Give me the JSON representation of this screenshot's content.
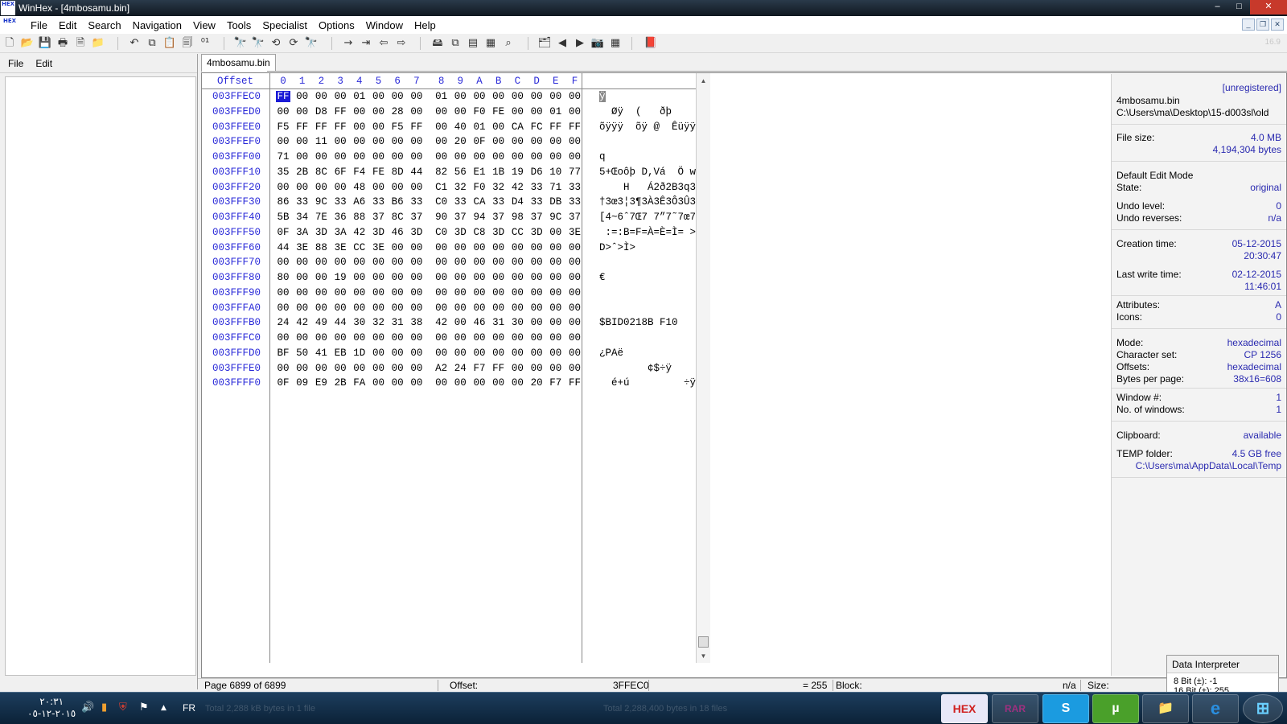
{
  "window": {
    "title": "WinHex - [4mbosamu.bin]",
    "app_icon_text": "HEX",
    "minimize": "–",
    "maximize": "□",
    "close": "✕"
  },
  "menu": [
    "File",
    "Edit",
    "Search",
    "Navigation",
    "View",
    "Tools",
    "Specialist",
    "Options",
    "Window",
    "Help"
  ],
  "mdi_controls": {
    "minimize": "_",
    "restore": "❐",
    "close": "✕"
  },
  "toolbar": {
    "version": "16.9",
    "icons": [
      "new-file-icon",
      "open-folder-icon",
      "save-icon",
      "print-icon",
      "properties-icon",
      "open-disk-icon",
      "undo-icon",
      "copy-icon",
      "paste-icon",
      "clipboard-data-icon",
      "convert-binary-icon",
      "find-text-icon",
      "find-hex-icon",
      "replace-text-icon",
      "replace-hex-icon",
      "find-again-icon",
      "goto-offset-icon",
      "goto-page-icon",
      "back-icon",
      "forward-icon",
      "open-disk-edit-icon",
      "clone-icon",
      "ram-icon",
      "calculator-icon",
      "magnifier-icon",
      "case-icon",
      "prev-page-icon",
      "next-page-icon",
      "camera-icon",
      "table-icon",
      "help-book-icon"
    ],
    "glyphs": [
      "🗋",
      "📂",
      "💾",
      "🖶",
      "🗎",
      "📁",
      "↶",
      "⧉",
      "📋",
      "🗐",
      "⁰¹",
      "🔭",
      "🔭",
      "⟲",
      "⟳",
      "🔭",
      "→",
      "⇥",
      "⇦",
      "⇨",
      "🖴",
      "⧉",
      "▤",
      "▦",
      "⌕",
      "🗂",
      "◀",
      "▶",
      "📷",
      "▦",
      "📕"
    ]
  },
  "left_panel": {
    "menu": [
      "File",
      "Edit"
    ]
  },
  "tab": {
    "label": "4mbosamu.bin"
  },
  "hex": {
    "header_offset": "Offset",
    "header_cols": [
      "0",
      "1",
      "2",
      "3",
      "4",
      "5",
      "6",
      "7",
      "8",
      "9",
      "A",
      "B",
      "C",
      "D",
      "E",
      "F"
    ],
    "rows": [
      {
        "offset": "003FFEC0",
        "bytes": [
          "FF",
          "00",
          "00",
          "00",
          "01",
          "00",
          "00",
          "00",
          "01",
          "00",
          "00",
          "00",
          "00",
          "00",
          "00",
          "00"
        ],
        "ascii": "ÿ"
      },
      {
        "offset": "003FFED0",
        "bytes": [
          "00",
          "00",
          "D8",
          "FF",
          "00",
          "00",
          "28",
          "00",
          "00",
          "00",
          "F0",
          "FE",
          "00",
          "00",
          "01",
          "00"
        ],
        "ascii": "  Øÿ  (   ðþ"
      },
      {
        "offset": "003FFEE0",
        "bytes": [
          "F5",
          "FF",
          "FF",
          "FF",
          "00",
          "00",
          "F5",
          "FF",
          "00",
          "40",
          "01",
          "00",
          "CA",
          "FC",
          "FF",
          "FF"
        ],
        "ascii": "õÿÿÿ  õÿ @  Êüÿÿ"
      },
      {
        "offset": "003FFEF0",
        "bytes": [
          "00",
          "00",
          "11",
          "00",
          "00",
          "00",
          "00",
          "00",
          "00",
          "20",
          "0F",
          "00",
          "00",
          "00",
          "00",
          "00"
        ],
        "ascii": ""
      },
      {
        "offset": "003FFF00",
        "bytes": [
          "71",
          "00",
          "00",
          "00",
          "00",
          "00",
          "00",
          "00",
          "00",
          "00",
          "00",
          "00",
          "00",
          "00",
          "00",
          "00"
        ],
        "ascii": "q"
      },
      {
        "offset": "003FFF10",
        "bytes": [
          "35",
          "2B",
          "8C",
          "6F",
          "F4",
          "FE",
          "8D",
          "44",
          "82",
          "56",
          "E1",
          "1B",
          "19",
          "D6",
          "10",
          "77"
        ],
        "ascii": "5+Œoôþ D,Vá  Ö w"
      },
      {
        "offset": "003FFF20",
        "bytes": [
          "00",
          "00",
          "00",
          "00",
          "48",
          "00",
          "00",
          "00",
          "C1",
          "32",
          "F0",
          "32",
          "42",
          "33",
          "71",
          "33"
        ],
        "ascii": "    H   Á2ð2B3q3"
      },
      {
        "offset": "003FFF30",
        "bytes": [
          "86",
          "33",
          "9C",
          "33",
          "A6",
          "33",
          "B6",
          "33",
          "C0",
          "33",
          "CA",
          "33",
          "D4",
          "33",
          "DB",
          "33"
        ],
        "ascii": "†3œ3¦3¶3À3Ê3Ô3Û3"
      },
      {
        "offset": "003FFF40",
        "bytes": [
          "5B",
          "34",
          "7E",
          "36",
          "88",
          "37",
          "8C",
          "37",
          "90",
          "37",
          "94",
          "37",
          "98",
          "37",
          "9C",
          "37"
        ],
        "ascii": "[4~6ˆ7Œ7 7”7˜7œ7"
      },
      {
        "offset": "003FFF50",
        "bytes": [
          "0F",
          "3A",
          "3D",
          "3A",
          "42",
          "3D",
          "46",
          "3D",
          "C0",
          "3D",
          "C8",
          "3D",
          "CC",
          "3D",
          "00",
          "3E"
        ],
        "ascii": " :=:B=F=À=È=Ì= >"
      },
      {
        "offset": "003FFF60",
        "bytes": [
          "44",
          "3E",
          "88",
          "3E",
          "CC",
          "3E",
          "00",
          "00",
          "00",
          "00",
          "00",
          "00",
          "00",
          "00",
          "00",
          "00"
        ],
        "ascii": "D>ˆ>Ì>"
      },
      {
        "offset": "003FFF70",
        "bytes": [
          "00",
          "00",
          "00",
          "00",
          "00",
          "00",
          "00",
          "00",
          "00",
          "00",
          "00",
          "00",
          "00",
          "00",
          "00",
          "00"
        ],
        "ascii": ""
      },
      {
        "offset": "003FFF80",
        "bytes": [
          "80",
          "00",
          "00",
          "19",
          "00",
          "00",
          "00",
          "00",
          "00",
          "00",
          "00",
          "00",
          "00",
          "00",
          "00",
          "00"
        ],
        "ascii": "€"
      },
      {
        "offset": "003FFF90",
        "bytes": [
          "00",
          "00",
          "00",
          "00",
          "00",
          "00",
          "00",
          "00",
          "00",
          "00",
          "00",
          "00",
          "00",
          "00",
          "00",
          "00"
        ],
        "ascii": ""
      },
      {
        "offset": "003FFFA0",
        "bytes": [
          "00",
          "00",
          "00",
          "00",
          "00",
          "00",
          "00",
          "00",
          "00",
          "00",
          "00",
          "00",
          "00",
          "00",
          "00",
          "00"
        ],
        "ascii": ""
      },
      {
        "offset": "003FFFB0",
        "bytes": [
          "24",
          "42",
          "49",
          "44",
          "30",
          "32",
          "31",
          "38",
          "42",
          "00",
          "46",
          "31",
          "30",
          "00",
          "00",
          "00"
        ],
        "ascii": "$BID0218B F10"
      },
      {
        "offset": "003FFFC0",
        "bytes": [
          "00",
          "00",
          "00",
          "00",
          "00",
          "00",
          "00",
          "00",
          "00",
          "00",
          "00",
          "00",
          "00",
          "00",
          "00",
          "00"
        ],
        "ascii": ""
      },
      {
        "offset": "003FFFD0",
        "bytes": [
          "BF",
          "50",
          "41",
          "EB",
          "1D",
          "00",
          "00",
          "00",
          "00",
          "00",
          "00",
          "00",
          "00",
          "00",
          "00",
          "00"
        ],
        "ascii": "¿PAë"
      },
      {
        "offset": "003FFFE0",
        "bytes": [
          "00",
          "00",
          "00",
          "00",
          "00",
          "00",
          "00",
          "00",
          "A2",
          "24",
          "F7",
          "FF",
          "00",
          "00",
          "00",
          "00"
        ],
        "ascii": "        ¢$÷ÿ"
      },
      {
        "offset": "003FFFF0",
        "bytes": [
          "0F",
          "09",
          "E9",
          "2B",
          "FA",
          "00",
          "00",
          "00",
          "00",
          "00",
          "00",
          "00",
          "00",
          "20",
          "F7",
          "FF"
        ],
        "ascii": "  é+ú         ÷ÿ"
      }
    ]
  },
  "info": {
    "registration": "[unregistered]",
    "filename": "4mbosamu.bin",
    "path": "C:\\Users\\ma\\Desktop\\15-d003sl\\old",
    "file_size_label": "File size:",
    "file_size": "4.0 MB",
    "file_size_bytes": "4,194,304 bytes",
    "edit_mode": "Default Edit Mode",
    "state_label": "State:",
    "state": "original",
    "undo_level_label": "Undo level:",
    "undo_level": "0",
    "undo_reverses_label": "Undo reverses:",
    "undo_reverses": "n/a",
    "creation_label": "Creation time:",
    "creation_date": "05-12-2015",
    "creation_time": "20:30:47",
    "write_label": "Last write time:",
    "write_date": "02-12-2015",
    "write_time": "11:46:01",
    "attributes_label": "Attributes:",
    "attributes": "A",
    "icons_label": "Icons:",
    "icons": "0",
    "mode_label": "Mode:",
    "mode": "hexadecimal",
    "charset_label": "Character set:",
    "charset": "CP 1256",
    "offsets_label": "Offsets:",
    "offsets": "hexadecimal",
    "bpp_label": "Bytes per page:",
    "bpp": "38x16=608",
    "window_label": "Window #:",
    "window_no": "1",
    "nwindows_label": "No. of windows:",
    "nwindows": "1",
    "clipboard_label": "Clipboard:",
    "clipboard": "available",
    "temp_label": "TEMP folder:",
    "temp_free": "4.5 GB free",
    "temp_path": "C:\\Users\\ma\\AppData\\Local\\Temp"
  },
  "status": {
    "page": "Page 6899 of 6899",
    "offset_label": "Offset:",
    "offset": "3FFEC0",
    "value": "= 255",
    "block_label": "Block:",
    "block": "n/a",
    "size_label": "Size:"
  },
  "data_interpreter": {
    "title": "Data Interpreter",
    "line1": "8 Bit (±): -1",
    "line2": "16 Bit (±): 255"
  },
  "taskbar": {
    "clock_time": "٢٠:٣١",
    "clock_date": "٢٠١٥-١٢-٠٥",
    "lang": "FR",
    "ghost_left": "Total 2,288 kB bytes in 1 file",
    "ghost_right": "Total 2,288,400 bytes in 18 files",
    "apps": [
      "HEX",
      "RAR",
      "S",
      "µ",
      "📁",
      "e",
      "⊞"
    ],
    "app_names": [
      "winhex-icon",
      "winrar-icon",
      "skype-icon",
      "utorrent-icon",
      "explorer-folder-icon",
      "ie-icon",
      "start-orb-icon"
    ]
  }
}
